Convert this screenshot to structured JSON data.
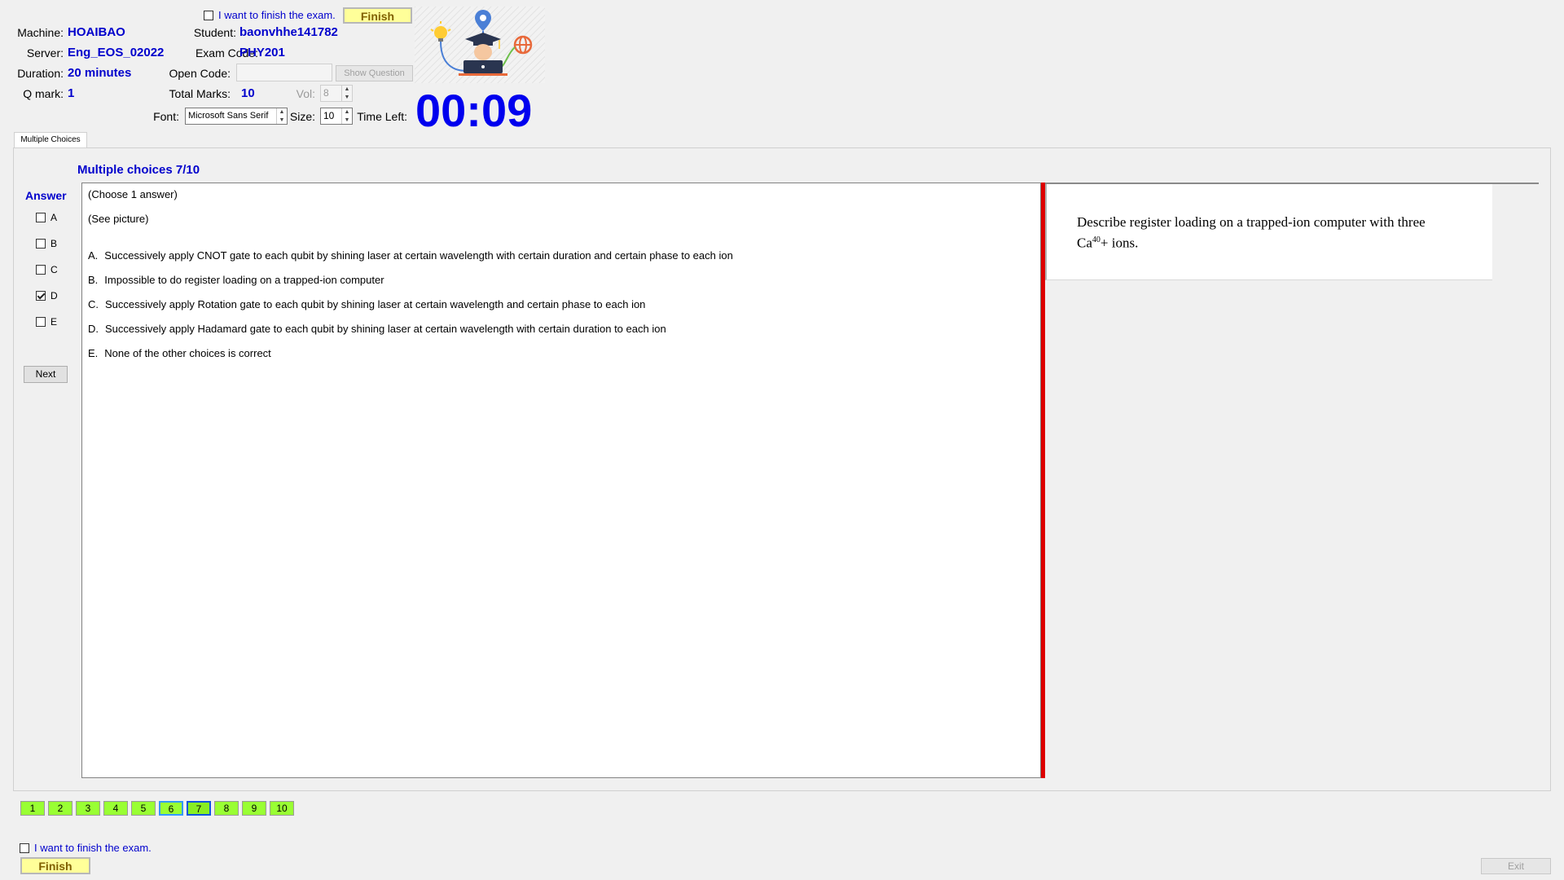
{
  "header": {
    "finish_check_label": "I want to finish the exam.",
    "finish_button": "Finish",
    "machine_label": "Machine:",
    "machine_value": "HOAIBAO",
    "server_label": "Server:",
    "server_value": "Eng_EOS_02022",
    "duration_label": "Duration:",
    "duration_value": "20 minutes",
    "qmark_label": "Q mark:",
    "qmark_value": "1",
    "student_label": "Student:",
    "student_value": "baonvhhe141782",
    "exam_code_label": "Exam Code:",
    "exam_code_value": "PHY201",
    "open_code_label": "Open Code:",
    "open_code_value": "",
    "show_question_button": "Show Question",
    "total_marks_label": "Total Marks:",
    "total_marks_value": "10",
    "vol_label": "Vol:",
    "vol_value": "8",
    "font_label": "Font:",
    "font_value": "Microsoft Sans Serif",
    "size_label": "Size:",
    "size_value": "10",
    "time_left_label": "Time Left:",
    "timer": "00:09"
  },
  "tab": {
    "label": "Multiple Choices"
  },
  "question": {
    "heading": "Multiple choices 7/10",
    "instruction": "(Choose 1 answer)",
    "see_picture": "(See picture)",
    "options": [
      {
        "letter": "A.",
        "text": "Successively apply CNOT gate to each qubit by shining laser at certain wavelength with certain duration and certain phase to each ion"
      },
      {
        "letter": "B.",
        "text": "Impossible to do register loading on a trapped-ion computer"
      },
      {
        "letter": "C.",
        "text": "Successively apply Rotation gate to each qubit by shining laser at certain wavelength and certain phase to each ion"
      },
      {
        "letter": "D.",
        "text": "Successively apply Hadamard gate to each qubit by shining laser at certain wavelength with certain duration to each ion"
      },
      {
        "letter": "E.",
        "text": "None of the other choices is correct"
      }
    ]
  },
  "picture": {
    "line1": "Describe register  loading on a trapped-ion computer with three",
    "line2_prefix": "Ca",
    "line2_superscript": "40",
    "line2_suffix": "+ ions."
  },
  "answer": {
    "title": "Answer",
    "choices": [
      {
        "label": "A",
        "checked": false
      },
      {
        "label": "B",
        "checked": false
      },
      {
        "label": "C",
        "checked": false
      },
      {
        "label": "D",
        "checked": true
      },
      {
        "label": "E",
        "checked": false
      }
    ],
    "next_button": "Next"
  },
  "navigation": {
    "questions": [
      "1",
      "2",
      "3",
      "4",
      "5",
      "6",
      "7",
      "8",
      "9",
      "10"
    ],
    "current": "7",
    "visited": "6"
  },
  "footer": {
    "finish_check_label": "I want to finish the exam.",
    "finish_button": "Finish",
    "exit_button": "Exit"
  },
  "colors": {
    "accent": "#0000cc",
    "nav_green": "#99ff33",
    "finish_yellow": "#ffff99",
    "divider_red": "#dd0000"
  }
}
